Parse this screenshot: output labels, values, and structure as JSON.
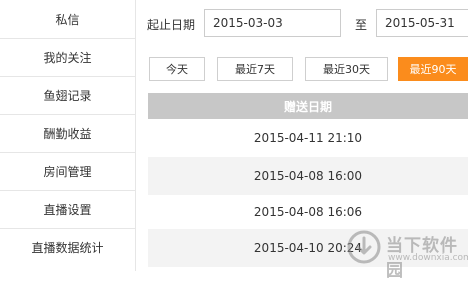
{
  "sidebar": {
    "items": [
      {
        "label": "私信"
      },
      {
        "label": "我的关注"
      },
      {
        "label": "鱼翅记录"
      },
      {
        "label": "酬勤收益"
      },
      {
        "label": "房间管理"
      },
      {
        "label": "直播设置"
      },
      {
        "label": "直播数据统计"
      }
    ]
  },
  "filter": {
    "start_label": "起止日期",
    "start_value": "2015-03-03",
    "to_label": "至",
    "end_value": "2015-05-31"
  },
  "quick_buttons": [
    {
      "label": "今天"
    },
    {
      "label": "最近7天"
    },
    {
      "label": "最近30天"
    },
    {
      "label": "最近90天",
      "active": true
    }
  ],
  "table": {
    "header": "赠送日期",
    "rows": [
      "2015-04-11 21:10",
      "2015-04-08 16:00",
      "2015-04-08 16:06",
      "2015-04-10 20:24"
    ]
  },
  "watermark": {
    "name": "当下软件园",
    "url": "www.downxia.com"
  },
  "colors": {
    "accent": "#fb8c1c",
    "table_header": "#c7c7c7",
    "row_alt": "#f3f3f3"
  }
}
